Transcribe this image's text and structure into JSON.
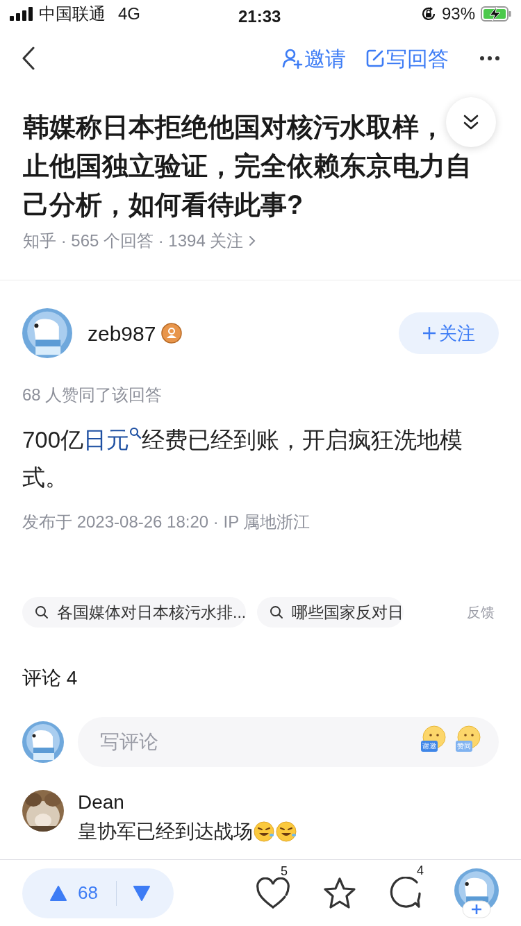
{
  "status_bar": {
    "carrier": "中国联通",
    "network": "4G",
    "time": "21:33",
    "battery": "93%",
    "charging": true
  },
  "nav": {
    "actions": [
      {
        "kind": "invite",
        "label": "邀请"
      },
      {
        "kind": "write",
        "label": "写回答"
      }
    ]
  },
  "question": {
    "title_parts": [
      "韩媒称日本拒绝他国对核污水取样，",
      "止他国独立验证，完全依赖东京电力自己分析，如何看待此事?"
    ],
    "meta": "知乎 · 565 个回答 · 1394 关注"
  },
  "answer": {
    "author": "zeb987",
    "follow": "关注",
    "votes_text": "68 人赞同了该回答",
    "body": {
      "before": "700亿",
      "link": "日元",
      "after": "经费已经到账，开启疯狂洗地模式。"
    },
    "published": "发布于 2023-08-26 18:20 · IP 属地浙江"
  },
  "related_searches": [
    "各国媒体对日本核污水排...",
    "哪些国家反对日"
  ],
  "feedback": "反馈",
  "comments": {
    "heading": "评论 4",
    "placeholder": "写评论",
    "stickers": [
      "谢邀",
      "赞同"
    ],
    "items": [
      {
        "author": "Dean",
        "text": "皇协军已经到达战场"
      }
    ]
  },
  "bottom_bar": {
    "votes": "68",
    "likes": "5",
    "comments": "4"
  }
}
